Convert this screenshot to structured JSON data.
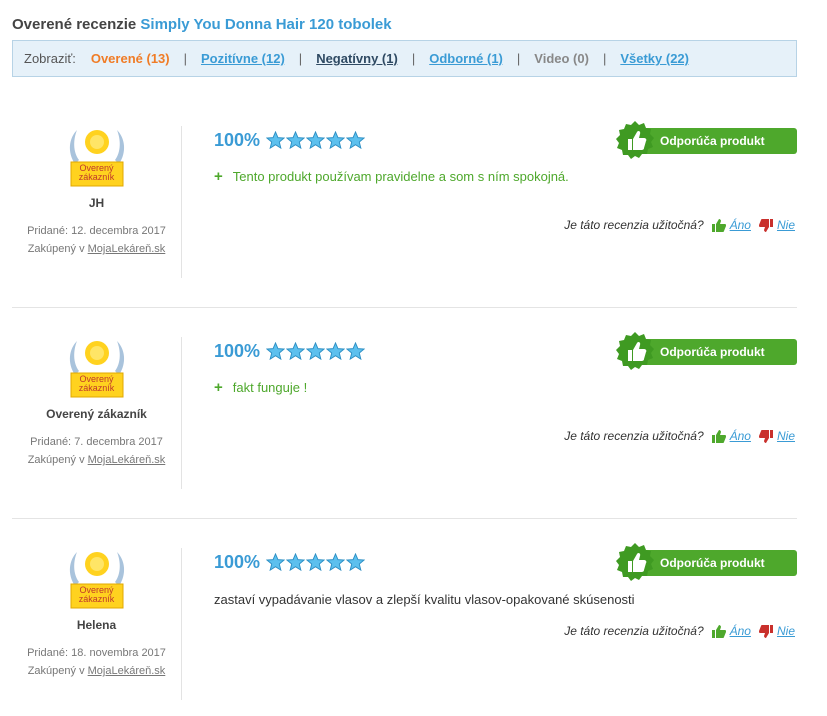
{
  "header": {
    "title_prefix": "Overené recenzie",
    "product_name": "Simply You Donna Hair 120 tobolek"
  },
  "filters": {
    "label": "Zobraziť:",
    "separator": "|",
    "options": [
      {
        "label": "Overené (13)",
        "state": "active"
      },
      {
        "label": "Pozitívne (12)",
        "state": "link"
      },
      {
        "label": "Negatívny (1)",
        "state": "current"
      },
      {
        "label": "Odborné (1)",
        "state": "link"
      },
      {
        "label": "Video (0)",
        "state": "disabled"
      },
      {
        "label": "Všetky (22)",
        "state": "link"
      }
    ]
  },
  "common": {
    "badge_line1": "Overený",
    "badge_line2": "zákazník",
    "added_prefix": "Pridané:",
    "bought_prefix": "Zakúpený v",
    "shop_name": "MojaLekáreň.sk",
    "recommend_label": "Odporúča produkt",
    "helpful_question": "Je táto recenzia užitočná?",
    "yes_label": "Áno",
    "no_label": "Nie",
    "plus_sign": "+",
    "star_rating": 5
  },
  "reviews": [
    {
      "author": "JH",
      "date": "12. decembra 2017",
      "rating": "100%",
      "text": "Tento produkt používam pravidelne a som s ním spokojná."
    },
    {
      "author": "Overený zákazník",
      "date": "7. decembra 2017",
      "rating": "100%",
      "text": "fakt funguje !"
    },
    {
      "author": "Helena",
      "date": "18. novembra 2017",
      "rating": "100%",
      "text": "zastaví vypadávanie vlasov a zlepší kvalitu vlasov-opakované skúsenosti"
    }
  ],
  "colors": {
    "accent_blue": "#3a9bd5",
    "active_orange": "#f07c26",
    "recommend_green": "#4ea82c",
    "filter_bg": "#e6f1f9"
  }
}
